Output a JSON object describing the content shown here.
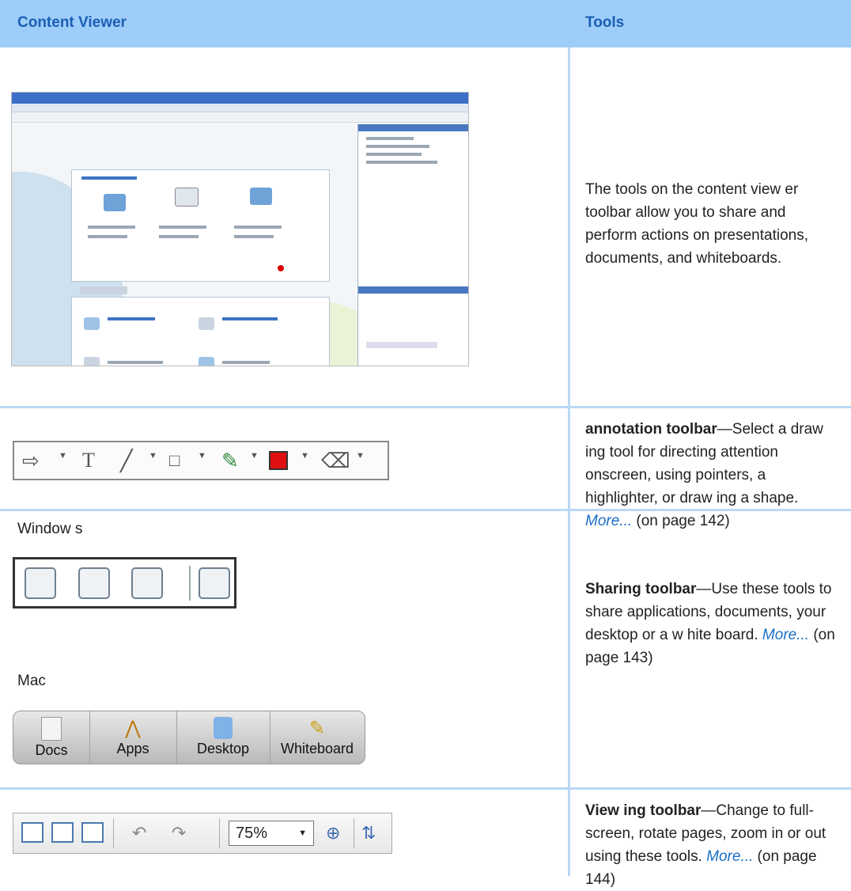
{
  "header": {
    "col1": "Content Viewer",
    "col2": "Tools"
  },
  "rows": [
    {
      "description": "The tools on the content view er toolbar allow you to share and perform actions on presentations, documents, and whiteboards."
    },
    {
      "title": "annotation toolbar",
      "description": "—Select a draw ing tool for directing attention onscreen, using pointers, a highlighter, or draw ing a shape. ",
      "link": "More...",
      "page_ref": " (on page 142)"
    },
    {
      "label_windows": "Window s",
      "label_mac": "Mac",
      "title": "Sharing toolbar",
      "description": "—Use these tools to share applications, documents, your desktop or a w hite board. ",
      "link": "More...",
      "page_ref": " (on page 143)",
      "mac_buttons": [
        "Docs",
        "Apps",
        "Desktop",
        "Whiteboard"
      ]
    },
    {
      "title": "View ing toolbar",
      "description": "—Change to full-screen, rotate pages, zoom in or out using these tools. ",
      "link": "More...",
      "page_ref": " (on page 144)",
      "zoom_value": "75%"
    }
  ],
  "icons": {
    "annotation": [
      "pointer-arrow-icon",
      "text-icon",
      "line-icon",
      "rectangle-icon",
      "pencil-icon",
      "color-icon",
      "eraser-icon"
    ],
    "windows_sharing": [
      "share-document-icon",
      "share-application-icon",
      "share-desktop-icon",
      "share-whiteboard-icon"
    ],
    "viewing": [
      "full-screen-icon",
      "thumbnail-view-icon",
      "sync-display-icon",
      "rotate-left-icon",
      "rotate-right-icon",
      "zoom-icon",
      "fit-icon"
    ]
  },
  "colors": {
    "header_bg": "#9fcdfa",
    "header_text": "#1a5fb4",
    "link": "#1a6ec8",
    "grid": "#b9d8f5",
    "annotation_red": "#e01010"
  }
}
